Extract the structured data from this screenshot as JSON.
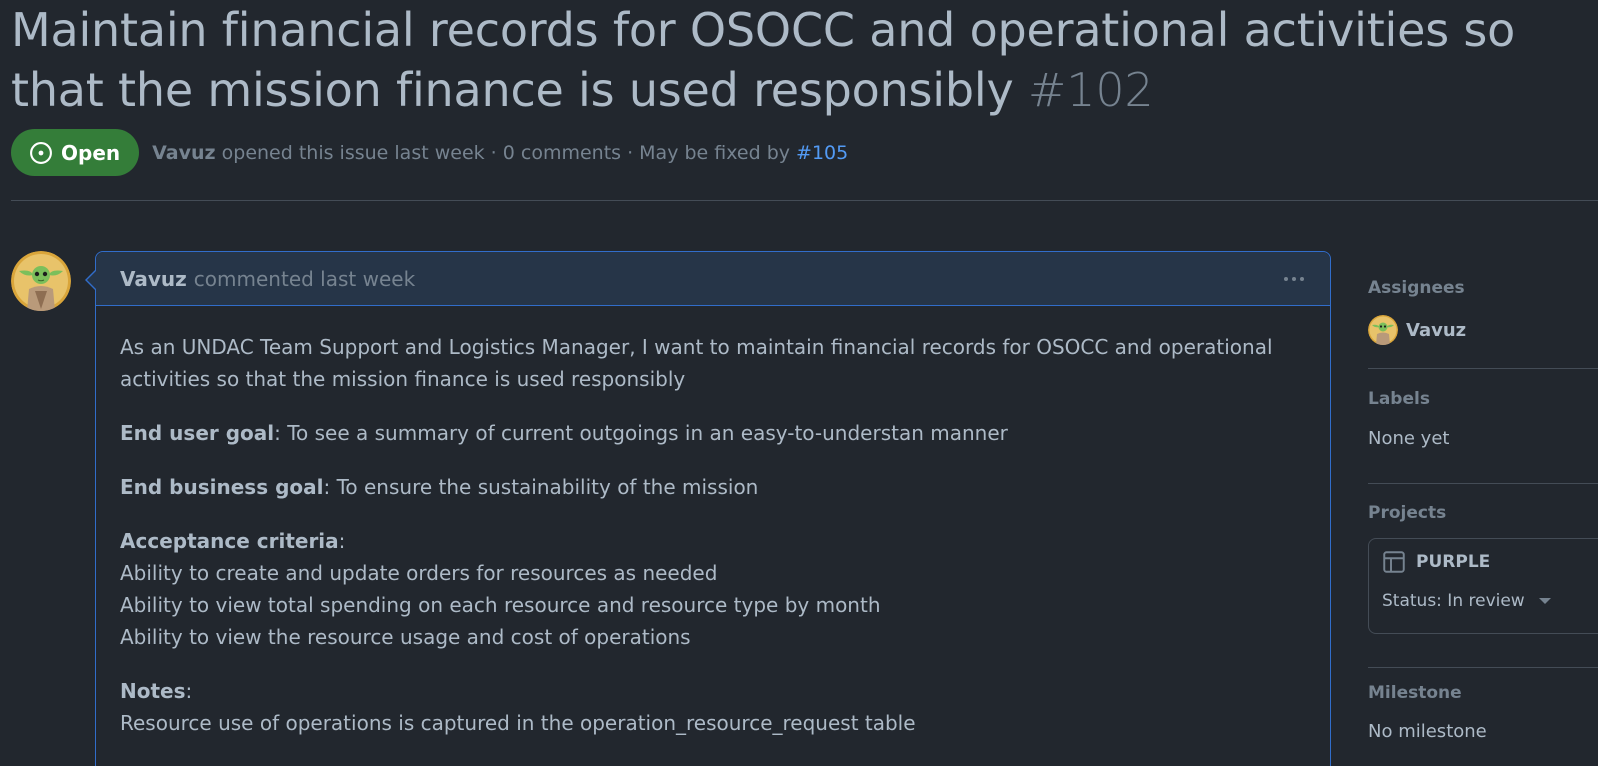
{
  "issue": {
    "title": "Maintain financial records for OSOCC and operational activities so that the mission finance is used responsibly",
    "number": "#102",
    "state": "Open",
    "author": "Vavuz",
    "opened_text": "opened this issue last week · 0 comments · May be fixed by",
    "fixed_by": "#105"
  },
  "comment": {
    "author": "Vavuz",
    "time_text": "commented last week",
    "intro": "As an UNDAC Team Support and Logistics Manager, I want to maintain financial records for OSOCC and operational activities so that the mission finance is used responsibly",
    "end_user_goal_label": "End user goal",
    "end_user_goal_text": ": To see a summary of current outgoings in an easy-to-understan manner",
    "end_business_goal_label": "End business goal",
    "end_business_goal_text": ": To ensure the sustainability of the mission",
    "acceptance_label": "Acceptance criteria",
    "acceptance_colon": ":",
    "acceptance_items": [
      "Ability to create and update orders for resources as needed",
      "Ability to view total spending on each resource and resource type by month",
      "Ability to view the resource usage and cost of operations"
    ],
    "notes_label": "Notes",
    "notes_colon": ":",
    "notes_text": "Resource use of operations is captured in the operation_resource_request table"
  },
  "sidebar": {
    "assignees_label": "Assignees",
    "assignee": "Vavuz",
    "labels_label": "Labels",
    "labels_value": "None yet",
    "projects_label": "Projects",
    "project_name": "PURPLE",
    "project_status": "Status: In review",
    "milestone_label": "Milestone",
    "milestone_value": "No milestone"
  },
  "colors": {
    "background": "#22272e",
    "open_badge": "#347d39",
    "link": "#539bf5",
    "comment_border": "#316dca",
    "comment_header": "#263548"
  },
  "icons": {
    "state": "issue-opened-icon",
    "menu": "kebab-horizontal-icon",
    "project": "table-icon",
    "status": "triangle-down-icon"
  }
}
